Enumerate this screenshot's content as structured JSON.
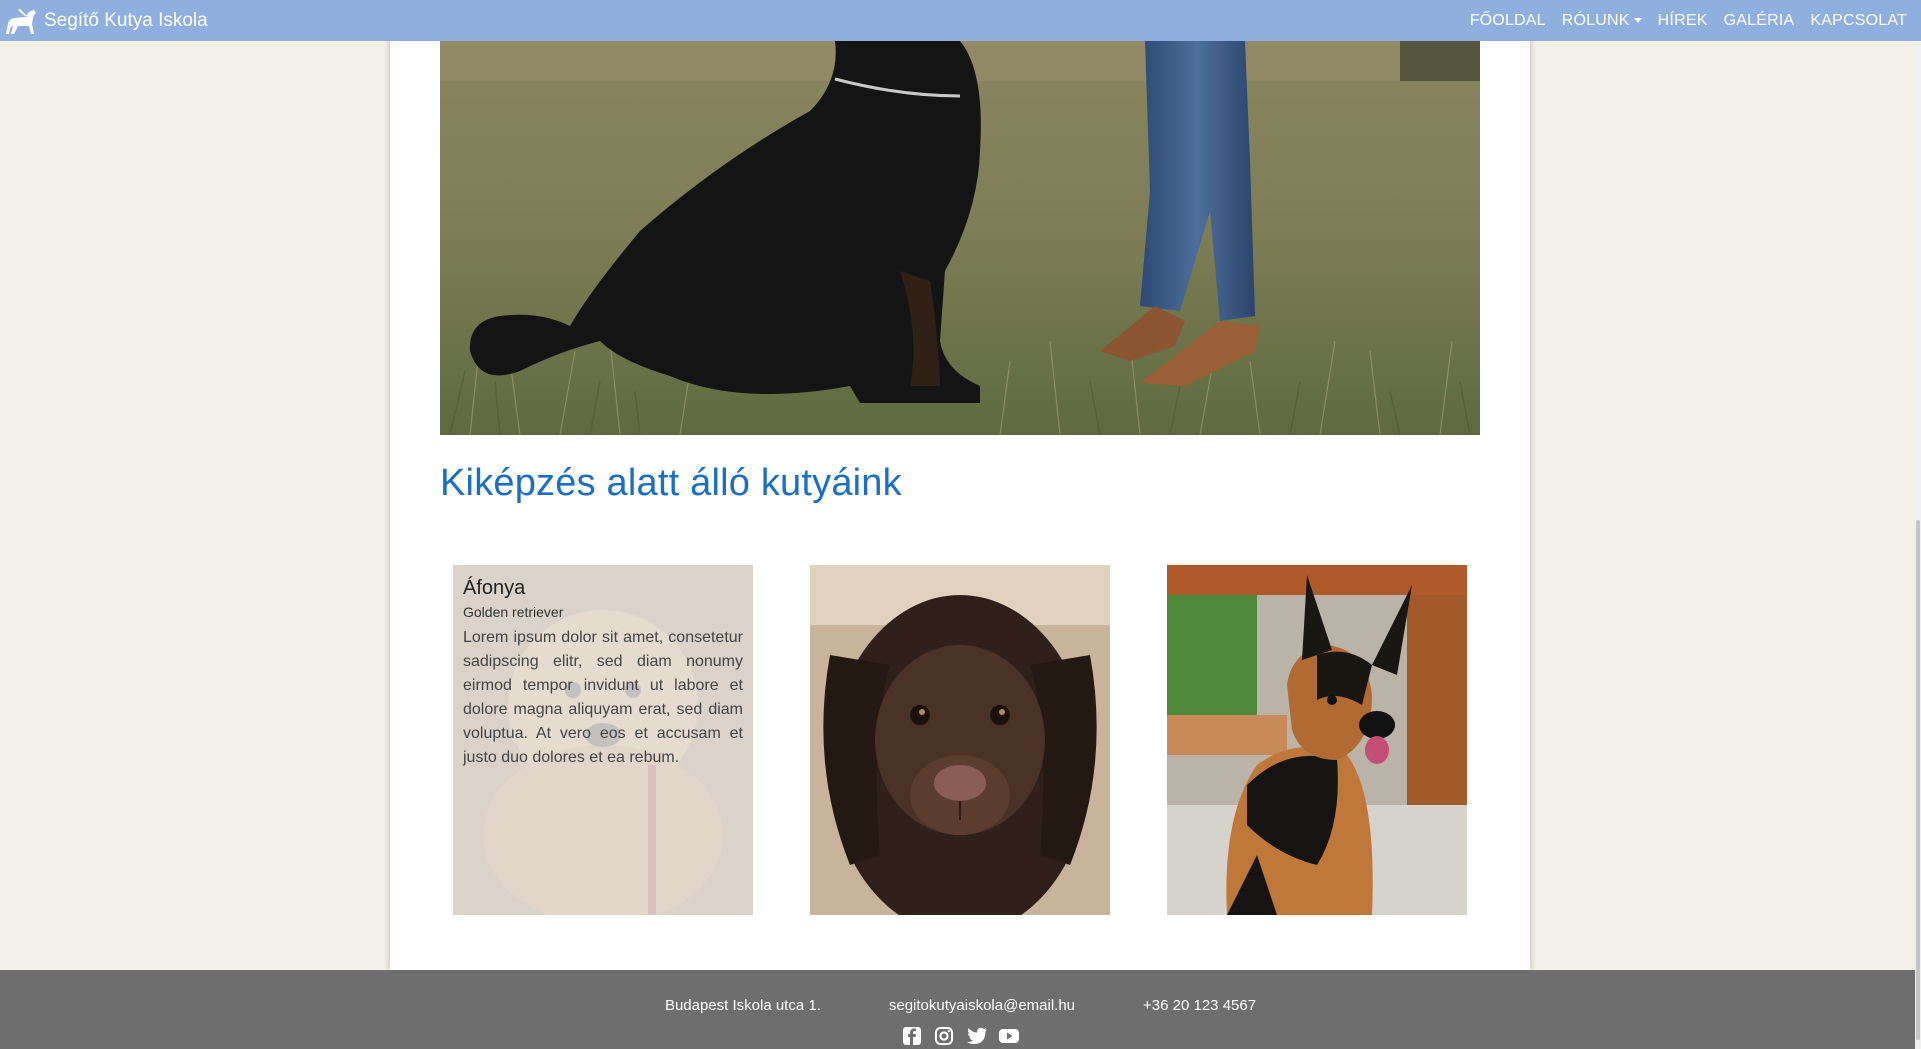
{
  "nav": {
    "brand": "Segítő Kutya Iskola",
    "brand_icon": "guide-dog-icon",
    "links": [
      {
        "label": "FŐOLDAL"
      },
      {
        "label": "RÓLUNK"
      },
      {
        "label": "HÍREK"
      },
      {
        "label": "GALÉRIA"
      },
      {
        "label": "KAPCSOLAT"
      }
    ]
  },
  "main": {
    "section_title": "Kiképzés alatt álló kutyáink",
    "cards": [
      {
        "name": "Áfonya",
        "breed": "Golden retriever",
        "text": "Lorem ipsum dolor sit amet, consetetur sadipscing elitr, sed diam nonumy eirmod tempor invidunt ut labore et dolore magna aliquyam erat, sed diam voluptua. At vero eos et accusam et justo duo dolores et ea rebum."
      }
    ]
  },
  "footer": {
    "address": "Budapest Iskola utca 1.",
    "email": "segitokutyaiskola@email.hu",
    "phone": "+36 20 123 4567",
    "icons": [
      "facebook-icon",
      "instagram-icon",
      "twitter-icon",
      "youtube-icon"
    ]
  },
  "colors": {
    "navbar": "#8fb0de",
    "accent": "#1a6fc4",
    "background": "#f3efe9",
    "footer": "#6e6e6e"
  }
}
